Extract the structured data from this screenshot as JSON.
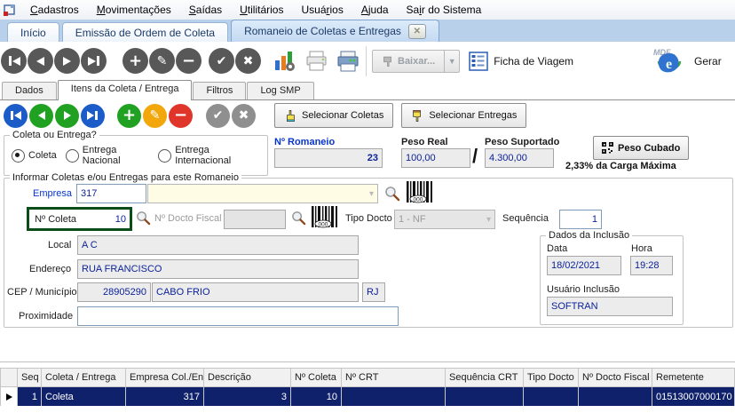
{
  "menu": {
    "items": [
      {
        "id": "cadastros",
        "label": "Cadastros",
        "u": 0
      },
      {
        "id": "movimentacoes",
        "label": "Movimentações",
        "u": 0
      },
      {
        "id": "saidas",
        "label": "Saídas",
        "u": 0
      },
      {
        "id": "utilitarios",
        "label": "Utilitários",
        "u": 0
      },
      {
        "id": "usuarios",
        "label": "Usuários",
        "u": 4
      },
      {
        "id": "ajuda",
        "label": "Ajuda",
        "u": 0
      },
      {
        "id": "sair-do-sistema",
        "label": "Sair do Sistema",
        "u": 2
      }
    ]
  },
  "tabs": [
    {
      "id": "inicio",
      "label": "Início",
      "active": false,
      "closable": false
    },
    {
      "id": "emissao-ordem-coleta",
      "label": "Emissão de Ordem de Coleta",
      "active": false,
      "closable": false
    },
    {
      "id": "romaneio-coletas-entregas",
      "label": "Romaneio de Coletas e Entregas",
      "active": true,
      "closable": true
    }
  ],
  "toolbar": {
    "baixar_label": "Baixar...",
    "ficha_viagem_label": "Ficha de Viagem",
    "gerar_label": "Gerar",
    "logo_text": "MDF",
    "logo_e": "e"
  },
  "subtabs": [
    {
      "id": "dados",
      "label": "Dados",
      "active": false
    },
    {
      "id": "itens-coleta-entrega",
      "label": "Itens da Coleta / Entrega",
      "active": true
    },
    {
      "id": "filtros",
      "label": "Filtros",
      "active": false
    },
    {
      "id": "log-smp",
      "label": "Log SMP",
      "active": false
    }
  ],
  "actions": {
    "selecionar_coletas": "Selecionar Coletas",
    "selecionar_entregas": "Selecionar Entregas"
  },
  "coleta_entrega": {
    "legend": "Coleta ou Entrega?",
    "options": [
      {
        "id": "coleta",
        "label": "Coleta",
        "selected": true
      },
      {
        "id": "entrega-nacional",
        "label": "Entrega Nacional",
        "selected": false
      },
      {
        "id": "entrega-internacional",
        "label": "Entrega Internacional",
        "selected": false
      }
    ]
  },
  "romaneio": {
    "numero_label": "Nº Romaneio",
    "numero_value": "23",
    "peso_real_label": "Peso Real",
    "peso_real_value": "100,00",
    "separator": "/",
    "peso_suportado_label": "Peso Suportado",
    "peso_suportado_value": "4.300,00",
    "peso_cubado_label": "Peso Cubado",
    "carga_maxima": "2,33% da Carga Máxima"
  },
  "informar": {
    "legend": "Informar Coletas e/ou Entregas para este Romaneio",
    "empresa_label": "Empresa",
    "empresa_value": "317",
    "empresa_descricao": "",
    "n_coleta_label": "Nº Coleta",
    "n_coleta_value": "10",
    "n_docto_label": "Nº Docto Fiscal",
    "n_docto_value": "",
    "tipo_docto_label": "Tipo Docto",
    "tipo_docto_value": "1 - NF",
    "sequencia_label": "Sequência",
    "sequencia_value": "1",
    "local_label": "Local",
    "local_value": "A C",
    "endereco_label": "Endereço",
    "endereco_value": "RUA FRANCISCO",
    "cep_label": "CEP / Município",
    "cep_value": "28905290",
    "municipio_value": "CABO FRIO",
    "uf_value": "RJ",
    "proximidade_label": "Proximidade",
    "proximidade_value": ""
  },
  "inclusao": {
    "legend": "Dados da Inclusão",
    "data_label": "Data",
    "data_value": "18/02/2021",
    "hora_label": "Hora",
    "hora_value": "19:28",
    "usuario_label": "Usuário Inclusão",
    "usuario_value": "SOFTRAN"
  },
  "table": {
    "columns": [
      "",
      "Seq",
      "Coleta / Entrega",
      "Empresa Col./Ent.",
      "Descrição",
      "Nº Coleta",
      "Nº CRT",
      "Sequência CRT",
      "Tipo Docto",
      "Nº Docto Fiscal",
      "Remetente"
    ],
    "rows": [
      {
        "seq": "1",
        "coleta_entrega": "Coleta",
        "empresa": "317",
        "descricao": "3",
        "n_coleta": "10",
        "n_crt": "",
        "sequencia_crt": "",
        "tipo_docto": "",
        "n_docto_fiscal": "",
        "remetente": "01513007000170",
        "selected": true
      }
    ]
  },
  "colors": {
    "tabstrip_bg": "#b9d0ea",
    "selected_row": "#10216b",
    "field_value_text": "#0d2299",
    "green_highlight_border": "#0b4d16",
    "combo_cream_bg": "#fffce6",
    "toolbar_circle_gray": "#585858",
    "nav_blue": "#1b5cc8",
    "nav_green": "#21a121",
    "edit_amber": "#f2a70c",
    "delete_red": "#e0352b"
  }
}
